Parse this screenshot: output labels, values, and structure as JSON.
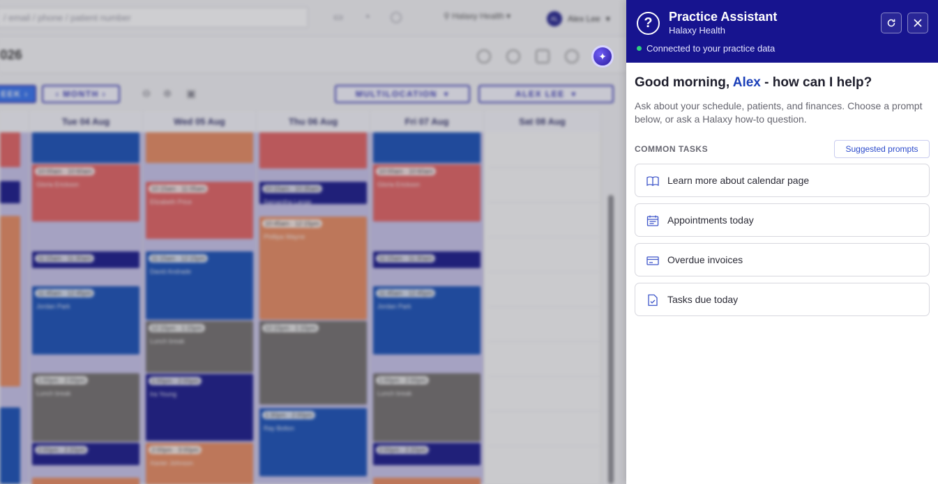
{
  "background": {
    "search": {
      "placeholder": "/ email / phone / patient number"
    },
    "top_right": {
      "location": "Halaxy Health",
      "user_initials": "AL",
      "user_name": "Alex Lee"
    },
    "year_label": "026",
    "toolbar": {
      "week_label": "EEK",
      "month_label": "MONTH",
      "multilocation_label": "MULTILOCATION",
      "practitioner_label": "ALEX LEE"
    },
    "days": [
      {
        "label": "Tue 04 Aug"
      },
      {
        "label": "Wed 05 Aug"
      },
      {
        "label": "Thu 06 Aug"
      },
      {
        "label": "Fri 07 Aug"
      },
      {
        "label": "Sat 08 Aug"
      }
    ],
    "appointments": {
      "tue": [
        {
          "time": "10:00am - 10:60am",
          "name": "Gloria Erickson"
        },
        {
          "time": "11:15am - 11:30am",
          "name": ""
        },
        {
          "time": "11:45am - 12:45pm",
          "name": "Jordan Park"
        },
        {
          "time": "1:00pm - 2:00pm",
          "name": "Lunch break"
        },
        {
          "time": "2:00pm - 2:20pm",
          "name": "Glory Ollivar"
        }
      ],
      "wed": [
        {
          "time": "10:15am - 11:05am",
          "name": "Elizabeth Price"
        },
        {
          "time": "11:15am - 12:15pm",
          "name": "David Andrade"
        },
        {
          "time": "12:15pm - 1:15pm",
          "name": "Lunch break"
        },
        {
          "time": "1:00pm - 2:00pm",
          "name": "Ira Young"
        },
        {
          "time": "2:00pm - 3:00pm",
          "name": "Xavier Johnson"
        }
      ],
      "thu": [
        {
          "time": "10:15am - 10:35am",
          "name": "Samantha Lange"
        },
        {
          "time": "10:45am - 12:15pm",
          "name": "Phillipa Wayne"
        },
        {
          "time": "12:15pm - 1:15pm",
          "name": ""
        },
        {
          "time": "1:30pm - 2:00pm",
          "name": "Ray Bolton"
        }
      ],
      "fri": [
        {
          "time": "10:00am - 10:60am",
          "name": "Gloria Erickson"
        },
        {
          "time": "11:15am - 11:30am",
          "name": ""
        },
        {
          "time": "11:45am - 12:45pm",
          "name": "Jordan Park"
        },
        {
          "time": "1:00pm - 2:00pm",
          "name": "Lunch break"
        },
        {
          "time": "2:00pm - 2:20pm",
          "name": "Glory Ollivar"
        }
      ]
    }
  },
  "assistant": {
    "title": "Practice Assistant",
    "subtitle": "Halaxy Health",
    "status": "Connected to your practice data",
    "greeting_prefix": "Good morning, ",
    "greeting_name": "Alex",
    "greeting_suffix": " - how can I help?",
    "intro": "Ask about your schedule, patients, and finances. Choose a prompt below, or ask a Halaxy how-to question.",
    "common_tasks_label": "COMMON TASKS",
    "suggested_prompts_label": "Suggested prompts",
    "tasks": [
      {
        "label": "Learn more about calendar page",
        "icon": "book-icon"
      },
      {
        "label": "Appointments today",
        "icon": "calendar-icon"
      },
      {
        "label": "Overdue invoices",
        "icon": "card-icon"
      },
      {
        "label": "Tasks due today",
        "icon": "checklist-icon"
      }
    ],
    "colors": {
      "header": "#17148f",
      "accent": "#1b3fb8",
      "status_dot": "#2ed17e"
    }
  }
}
